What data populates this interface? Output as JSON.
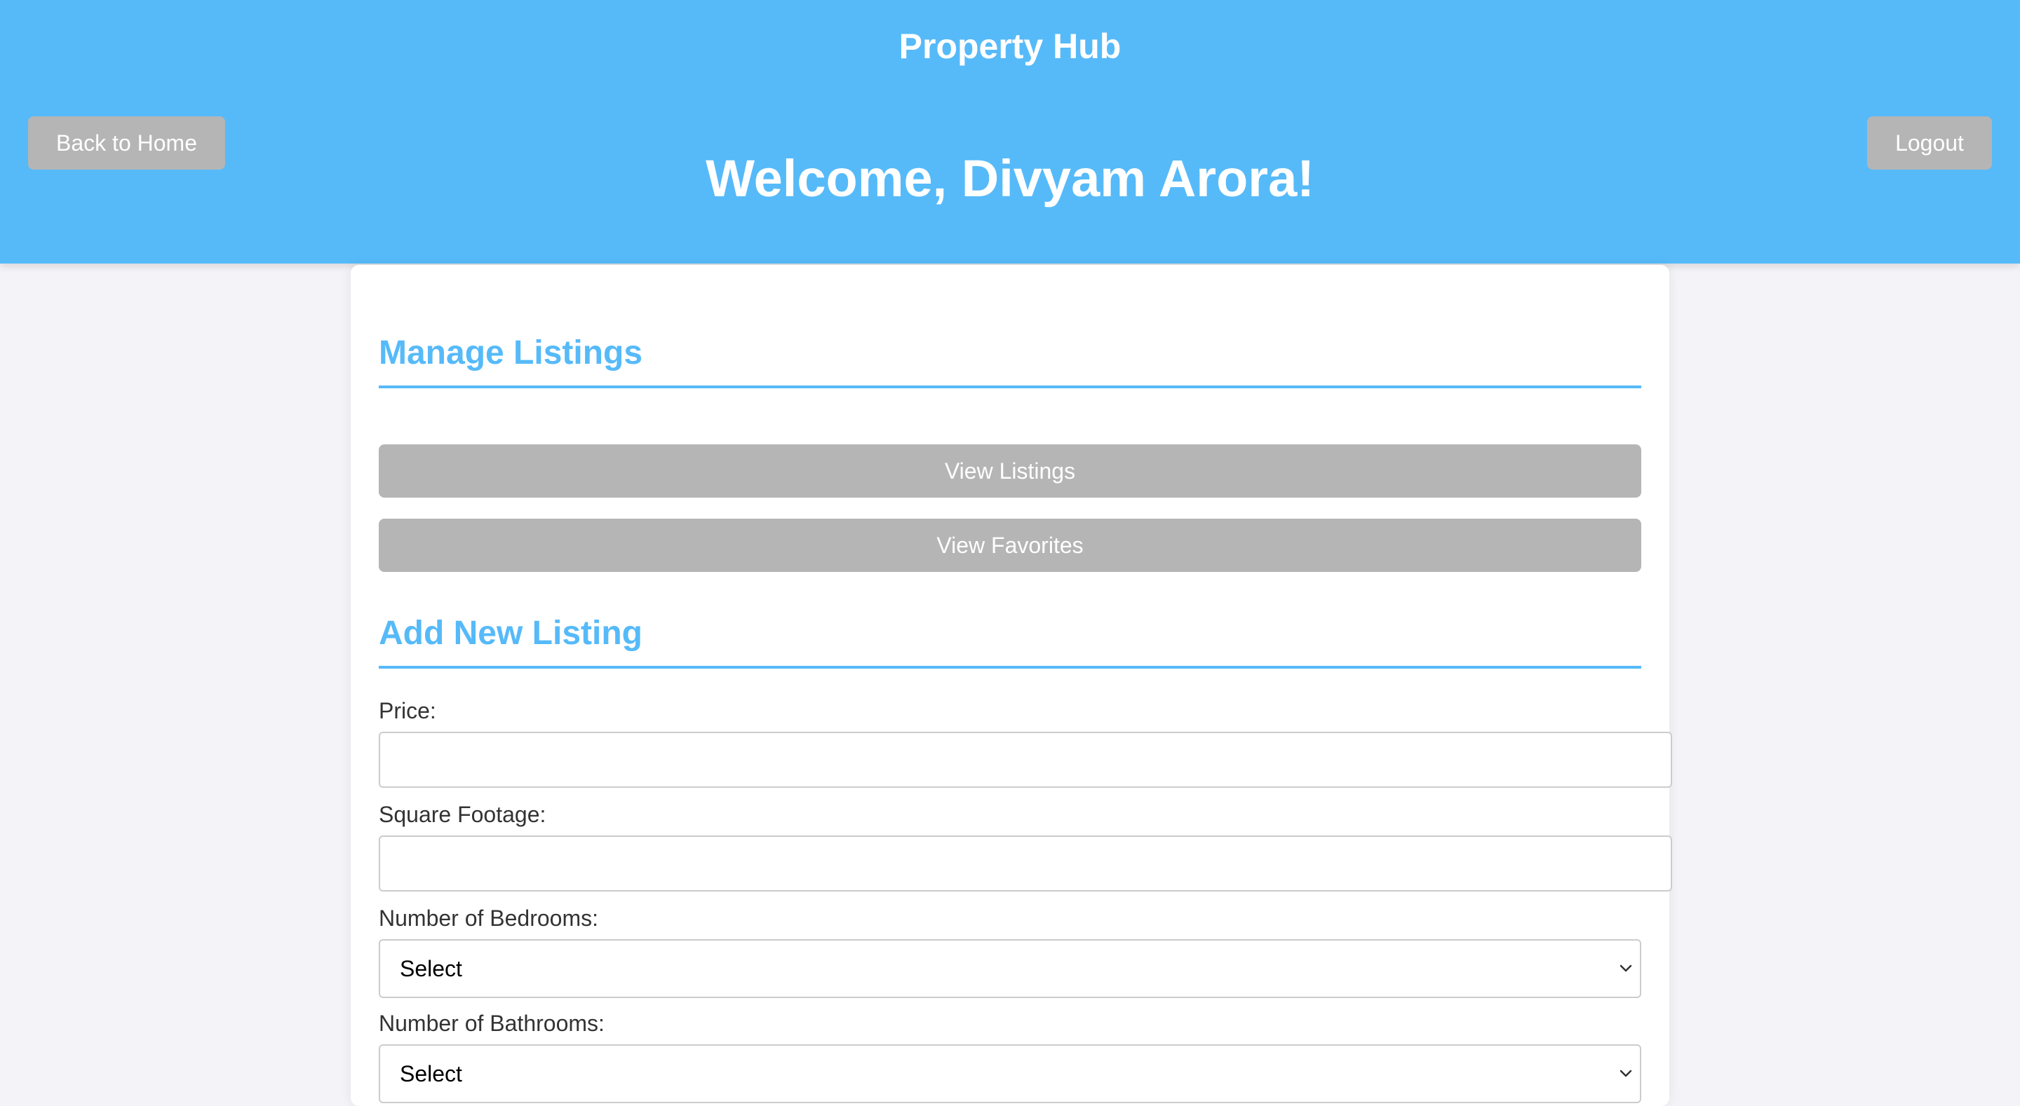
{
  "header": {
    "brand": "Property Hub",
    "welcome": "Welcome, Divyam Arora!",
    "back_label": "Back to Home",
    "logout_label": "Logout"
  },
  "manage": {
    "title": "Manage Listings",
    "view_listings_label": "View Listings",
    "view_favorites_label": "View Favorites"
  },
  "add_listing": {
    "title": "Add New Listing",
    "price_label": "Price:",
    "price_value": "",
    "sqft_label": "Square Footage:",
    "sqft_value": "",
    "bedrooms_label": "Number of Bedrooms:",
    "bedrooms_selected": "Select",
    "bathrooms_label": "Number of Bathrooms:",
    "bathrooms_selected": "Select"
  },
  "icons": {
    "select_arrow": "chevron-down-icon"
  },
  "colors": {
    "accent": "#56baf9",
    "button_gray": "#b5b5b5",
    "page_background": "#f4f4f8"
  }
}
